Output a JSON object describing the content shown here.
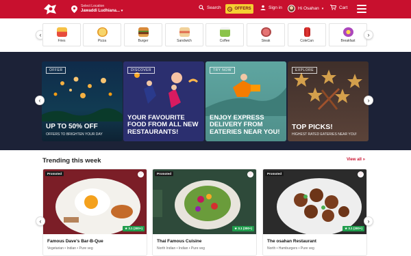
{
  "header": {
    "location_caption": "Select Location",
    "location_value": "Jawaddi Ludhiana...",
    "search_label": "Search",
    "offers_label": "OFFERS",
    "signin_label": "Sign in",
    "user_label": "Hi Osahan",
    "cart_label": "Cart"
  },
  "categories": [
    {
      "label": "Fries",
      "icon": "fries-icon",
      "color": "#e74c3c"
    },
    {
      "label": "Pizza",
      "icon": "pizza-icon",
      "color": "#f39c12"
    },
    {
      "label": "Burger",
      "icon": "burger-icon",
      "color": "#c0712b"
    },
    {
      "label": "Sandwich",
      "icon": "sandwich-icon",
      "color": "#e0b36a"
    },
    {
      "label": "Coffee",
      "icon": "coffee-icon",
      "color": "#8bc34a"
    },
    {
      "label": "Steak",
      "icon": "steak-icon",
      "color": "#e57373"
    },
    {
      "label": "ColeCan",
      "icon": "can-icon",
      "color": "#e53935"
    },
    {
      "label": "Breakfast",
      "icon": "breakfast-icon",
      "color": "#ab47bc"
    }
  ],
  "banners": [
    {
      "tag": "OFFER",
      "headline": "UP TO 50% OFF",
      "sub": "OFFERS TO BRIGHTEN YOUR DAY"
    },
    {
      "tag": "DISCOVER",
      "headline": "YOUR FAVOURITE FOOD FROM ALL NEW RESTAURANTS!",
      "sub": ""
    },
    {
      "tag": "TRY NOW",
      "headline": "ENJOY EXPRESS DELIVERY FROM EATERIES NEAR YOU!",
      "sub": ""
    },
    {
      "tag": "EXPLORE",
      "headline": "TOP PICKS!",
      "sub": "HIGHEST RATED EATERIES NEAR YOU!"
    }
  ],
  "trending": {
    "title": "Trending this week",
    "view_all": "View all",
    "restaurants": [
      {
        "promo": "Promoted",
        "rating": "3.1 (300+)",
        "name": "Famous Dave's Bar-B-Que",
        "desc": "Vegetarian • Indian • Pure veg"
      },
      {
        "promo": "Promoted",
        "rating": "3.1 (300+)",
        "name": "Thai Famous Cuisine",
        "desc": "North Indian • Indian • Pure veg"
      },
      {
        "promo": "Promoted",
        "rating": "3.1 (300+)",
        "name": "The osahan Restaurant",
        "desc": "North • Hamburgers • Pure veg"
      }
    ]
  },
  "colors": {
    "brand": "#c8102e",
    "offers_bg": "#f5d033",
    "banner_bg": "#1c2237",
    "rating_green": "#1f9d4c"
  }
}
